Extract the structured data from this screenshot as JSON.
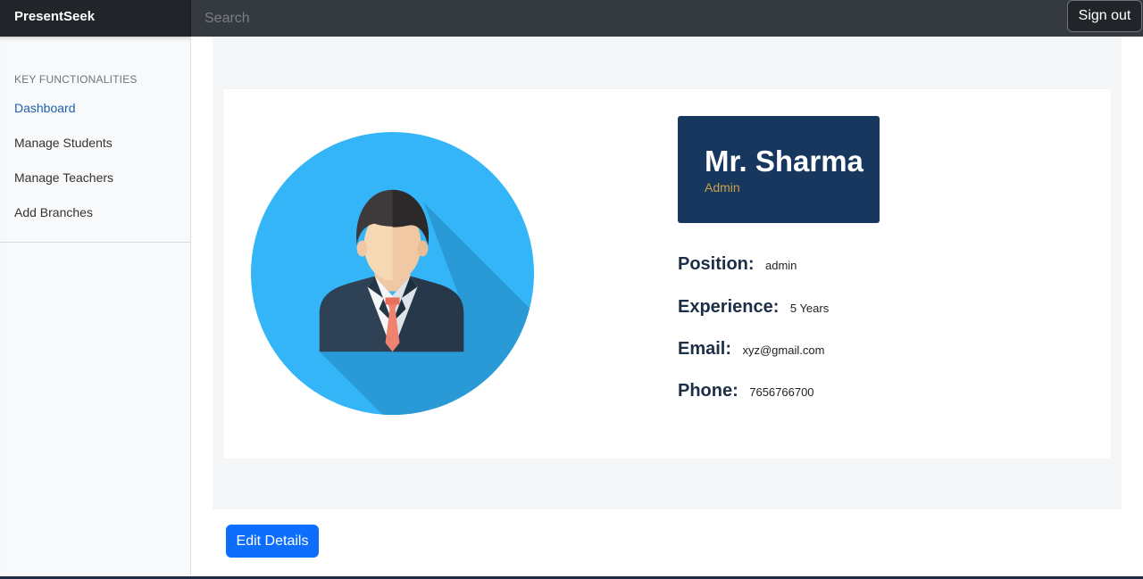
{
  "navbar": {
    "brand": "PresentSeek",
    "search_placeholder": "Search",
    "sign_out_label": "Sign out"
  },
  "sidebar": {
    "heading": "KEY FUNCTIONALITIES",
    "items": [
      {
        "label": "Dashboard",
        "active": true
      },
      {
        "label": "Manage Students",
        "active": false
      },
      {
        "label": "Manage Teachers",
        "active": false
      },
      {
        "label": "Add Branches",
        "active": false
      }
    ]
  },
  "profile": {
    "name": "Mr. Sharma",
    "role": "Admin",
    "avatar_icon": "user-avatar-icon",
    "fields": [
      {
        "label": "Position:",
        "value": "admin"
      },
      {
        "label": "Experience:",
        "value": "5 Years"
      },
      {
        "label": "Email:",
        "value": "xyz@gmail.com"
      },
      {
        "label": "Phone:",
        "value": "7656766700"
      }
    ]
  },
  "actions": {
    "edit_label": "Edit Details"
  },
  "colors": {
    "navbar": "#343a40",
    "brand_bg": "#212529",
    "name_box": "#17375e",
    "role_text": "#c9a24a",
    "primary_button": "#0d6efd",
    "avatar_circle": "#33b5f7"
  }
}
